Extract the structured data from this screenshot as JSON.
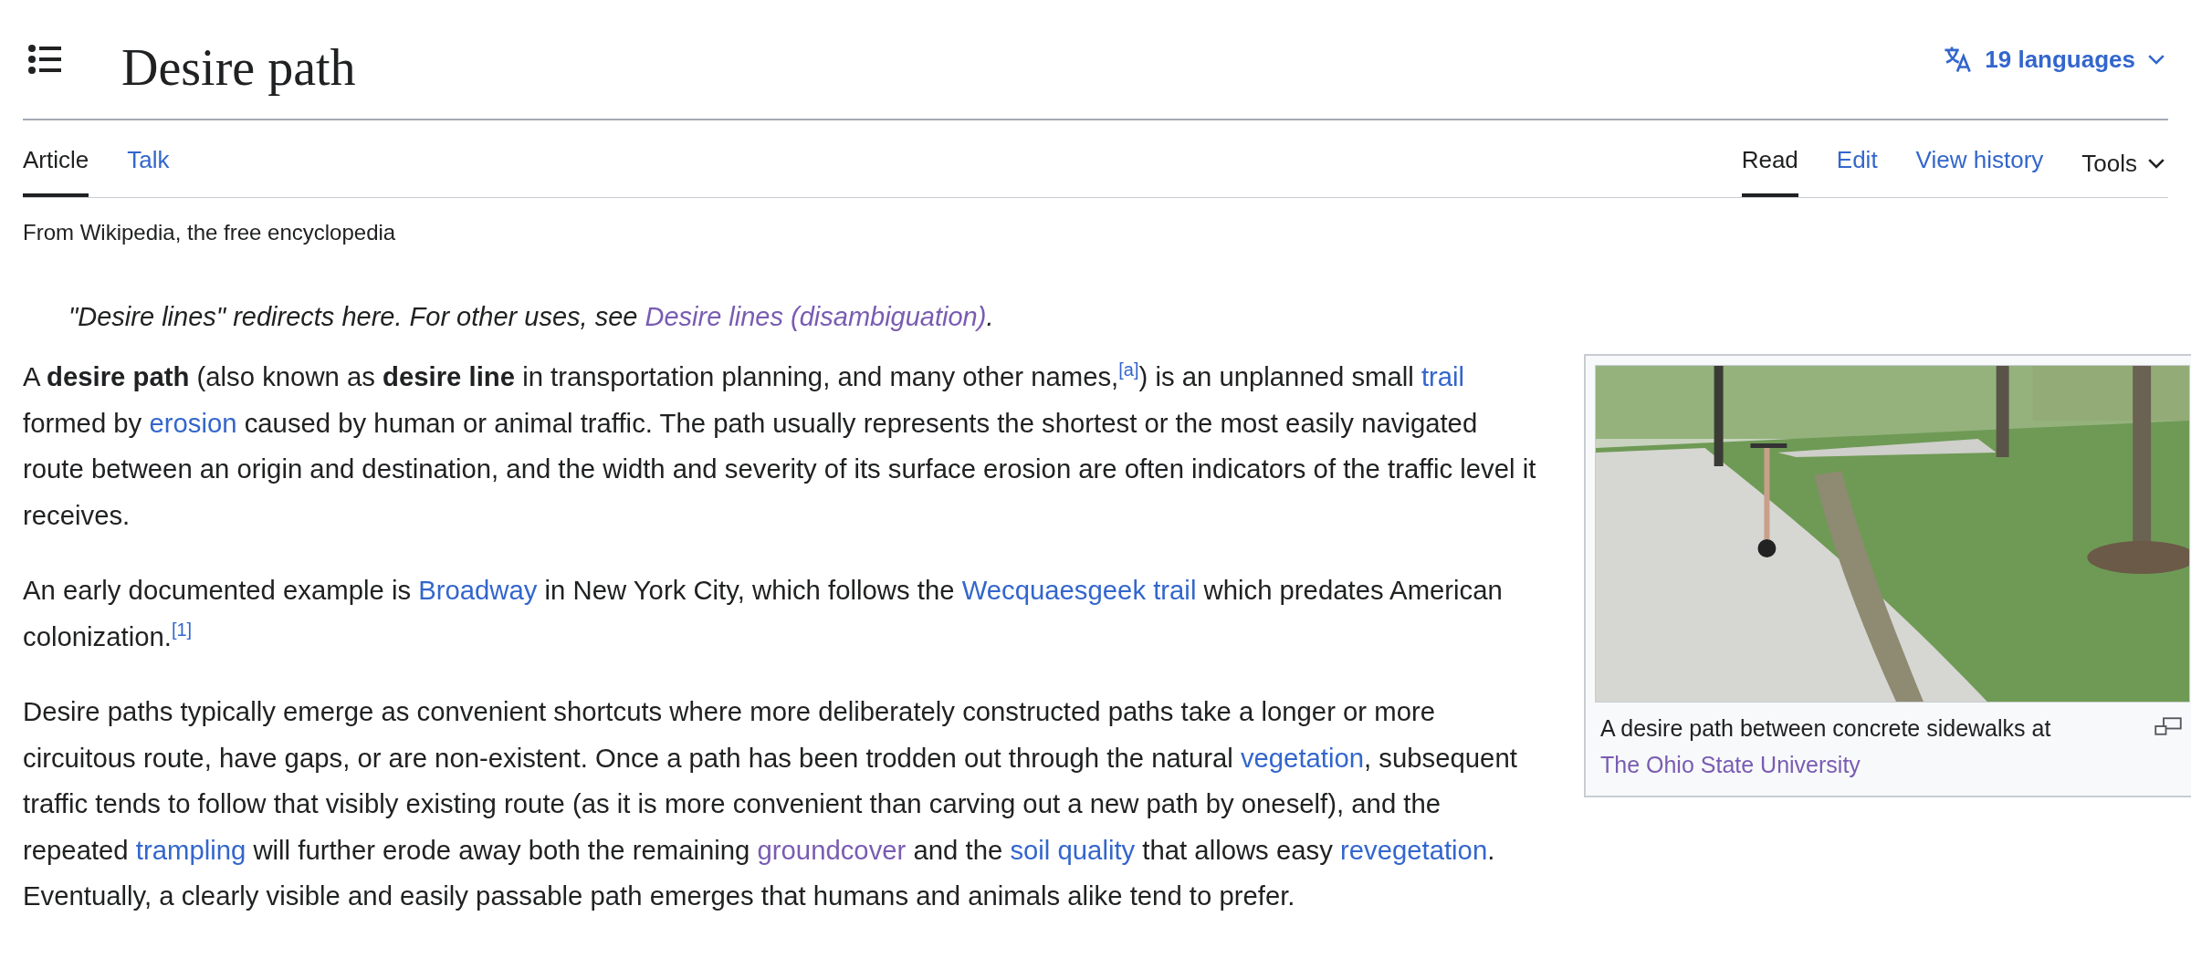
{
  "header": {
    "title": "Desire path",
    "languages": "19 languages"
  },
  "tabs_left": [
    {
      "label": "Article",
      "selected": true
    },
    {
      "label": "Talk",
      "selected": false
    }
  ],
  "tabs_right": [
    {
      "label": "Read",
      "selected": true
    },
    {
      "label": "Edit",
      "selected": false
    },
    {
      "label": "View history",
      "selected": false
    }
  ],
  "tools": {
    "label": "Tools"
  },
  "tagline": "From Wikipedia, the free encyclopedia",
  "hatnote": [
    {
      "kind": "text",
      "text": "\"Desire lines\" redirects here. For other uses, see "
    },
    {
      "kind": "link",
      "text": "Desire lines (disambiguation)",
      "visited": true
    },
    {
      "kind": "text",
      "text": "."
    }
  ],
  "figure": {
    "kind": "picture",
    "caption": [
      {
        "kind": "text",
        "text": "A desire path between concrete sidewalks at "
      },
      {
        "kind": "link",
        "text": "The Ohio State University",
        "visited": true
      }
    ]
  },
  "paragraphs": [
    [
      {
        "kind": "text",
        "text": "A **desire path** (also known as **desire line** in transportation planning, and many other names,"
      },
      {
        "kind": "ref",
        "text": "[a]",
        "visited": false
      },
      {
        "kind": "text",
        "text": ") is an unplanned small "
      },
      {
        "kind": "link",
        "text": "trail",
        "visited": false
      },
      {
        "kind": "text",
        "text": " formed by "
      },
      {
        "kind": "link",
        "text": "erosion",
        "visited": false
      },
      {
        "kind": "text",
        "text": " caused by human or animal traffic. The path usually represents the shortest or the most easily navigated route between an origin and destination, and the width and severity of its surface erosion are often indicators of the traffic level it receives."
      }
    ],
    [
      {
        "kind": "text",
        "text": "An early documented example is "
      },
      {
        "kind": "link",
        "text": "Broadway",
        "visited": false
      },
      {
        "kind": "text",
        "text": " in New York City, which follows the "
      },
      {
        "kind": "link",
        "text": "Wecquaesgeek trail",
        "visited": false
      },
      {
        "kind": "text",
        "text": " which predates American colonization."
      },
      {
        "kind": "ref",
        "text": "[1]",
        "visited": false
      }
    ],
    [
      {
        "kind": "text",
        "text": "Desire paths typically emerge as convenient shortcuts where more deliberately constructed paths take a longer or more circuitous route, have gaps, or are non-existent. Once a path has been trodden out through the natural "
      },
      {
        "kind": "link",
        "text": "vegetation",
        "visited": false
      },
      {
        "kind": "text",
        "text": ", subsequent traffic tends to follow that visibly existing route (as it is more convenient than carving out a new path by oneself), and the repeated "
      },
      {
        "kind": "link",
        "text": "trampling",
        "visited": false
      },
      {
        "kind": "text",
        "text": " will further erode away both the remaining "
      },
      {
        "kind": "link",
        "text": "groundcover",
        "visited": true
      },
      {
        "kind": "text",
        "text": " and the "
      },
      {
        "kind": "link",
        "text": "soil quality",
        "visited": false
      },
      {
        "kind": "text",
        "text": " that allows easy "
      },
      {
        "kind": "link",
        "text": "revegetation",
        "visited": false
      },
      {
        "kind": "text",
        "text": ". Eventually, a clearly visible and easily passable path emerges that humans and animals alike tend to prefer."
      }
    ]
  ]
}
